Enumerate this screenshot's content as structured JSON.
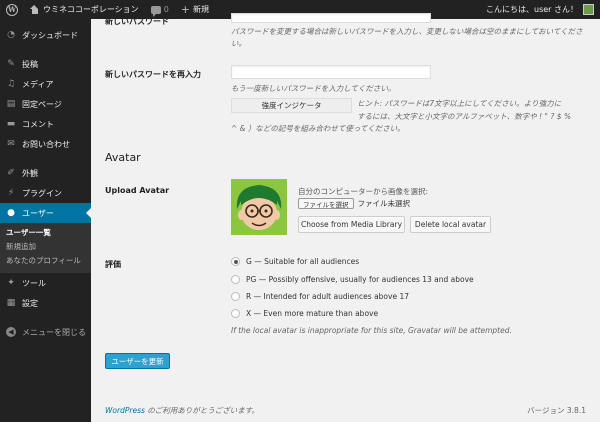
{
  "adminbar": {
    "site_name": "ウミネココーポレーション",
    "comments_count": "0",
    "new_label": "新規",
    "greeting": "こんにちは、user さん！"
  },
  "sidebar": {
    "items": [
      {
        "label": "ダッシュボード",
        "icon": "dashboard-icon"
      },
      {
        "label": "投稿",
        "icon": "pin-icon"
      },
      {
        "label": "メディア",
        "icon": "media-icon"
      },
      {
        "label": "固定ページ",
        "icon": "page-icon"
      },
      {
        "label": "コメント",
        "icon": "comment-icon"
      },
      {
        "label": "お問い合わせ",
        "icon": "mail-icon"
      },
      {
        "label": "外観",
        "icon": "brush-icon"
      },
      {
        "label": "プラグイン",
        "icon": "plugin-icon"
      },
      {
        "label": "ユーザー",
        "icon": "user-icon"
      },
      {
        "label": "ツール",
        "icon": "wrench-icon"
      },
      {
        "label": "設定",
        "icon": "settings-icon"
      }
    ],
    "submenu": [
      "ユーザー一覧",
      "新規追加",
      "あなたのプロフィール"
    ],
    "collapse_label": "メニューを閉じる"
  },
  "form": {
    "new_password_label": "新しいパスワード",
    "new_password_desc": "パスワードを変更する場合は新しいパスワードを入力し、変更しない場合は空のままにしておいてくださ",
    "new_password_desc2": "い。",
    "repeat_label": "新しいパスワードを再入力",
    "repeat_desc": "もう一度新しいパスワードを入力してください。",
    "strength_label": "強度インジケータ",
    "hint_line1": "ヒント: パスワードは7文字以上にしてください。より強力に",
    "hint_line2": "するには、大文字と小文字のアルファベット、数字や ! \" ? $ %",
    "hint_line3": "^ & ）などの記号を組み合わせて使ってください。",
    "avatar_section": "Avatar",
    "upload_label": "Upload Avatar",
    "upload_prompt": "自分のコンピューターから画像を選択:",
    "file_button": "ファイルを選択",
    "file_status": "ファイル未選択",
    "media_library_button": "Choose from Media Library",
    "delete_local_button": "Delete local avatar",
    "rating_label": "評価",
    "ratings": [
      "G — Suitable for all audiences",
      "PG — Possibly offensive, usually for audiences 13 and above",
      "R — Intended for adult audiences above 17",
      "X — Even more mature than above"
    ],
    "rating_selected": 0,
    "rating_note": "If the local avatar is inappropriate for this site, Gravatar will be attempted.",
    "submit_button": "ユーザーを更新"
  },
  "footer": {
    "wordpress_link": "WordPress",
    "thanks": " のご利用ありがとうございます。",
    "version": "バージョン 3.8.1"
  }
}
